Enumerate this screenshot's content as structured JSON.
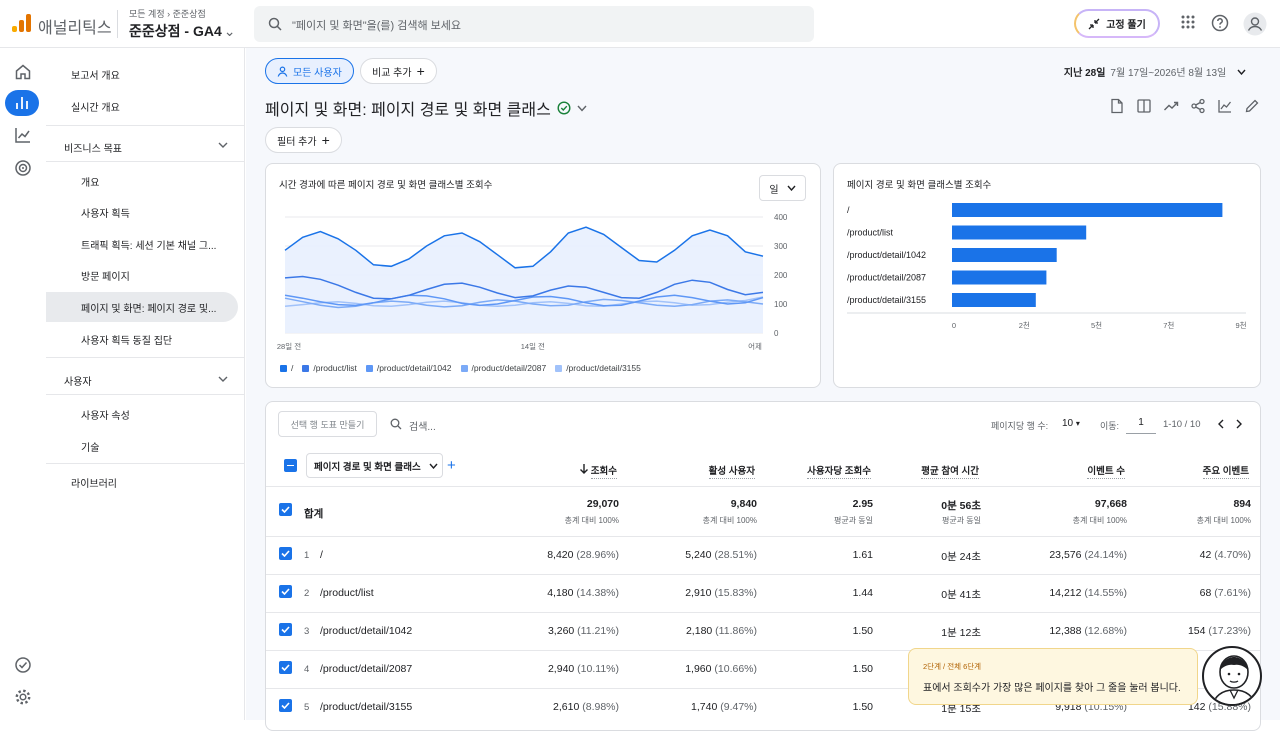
{
  "app": {
    "title": "애널리틱스",
    "breadcrumb": [
      "모든 계정",
      "준준상점"
    ],
    "property": "준준상점 - GA4",
    "search_placeholder": "\"페이지 및 화면\"을(를) 검색해 보세요",
    "pin_label": "고정 풀기",
    "logo_colors": [
      "#f9ab00",
      "#e37400",
      "#e37400"
    ]
  },
  "sidebar": {
    "items_top": [
      "보고서 개요",
      "실시간 개요"
    ],
    "section1": "비즈니스 목표",
    "section1_items": [
      "개요",
      "사용자 획득",
      "트래픽 획득: 세션 기본 채널 그...",
      "방문 페이지",
      "페이지 및 화면: 페이지 경로 및...",
      "사용자 획득 동질 집단"
    ],
    "section2": "사용자",
    "section2_items": [
      "사용자 속성",
      "기술"
    ],
    "library": "라이브러리"
  },
  "toolbar": {
    "segment": "모든 사용자",
    "compare": "비교 추가",
    "date_label": "지난 28일",
    "date_range": "7월 17일~2026년 8월 13일",
    "title": "페이지 및 화면: 페이지 경로 및 화면 클래스",
    "filter": "필터 추가"
  },
  "line_card": {
    "title": "시간 경과에 따른 페이지 경로 및 화면 클래스별 조회수",
    "granularity": "일",
    "yticks": [
      "400",
      "300",
      "200",
      "100",
      "0"
    ],
    "xticks": [
      "28일 전",
      "14일 전",
      "어제"
    ]
  },
  "bar_card": {
    "title": "페이지 경로 및 화면 클래스별 조회수",
    "xticks": [
      "0",
      "2천",
      "5천",
      "7천",
      "9천"
    ]
  },
  "chart_data": [
    {
      "type": "line",
      "title": "시간 경과에 따른 페이지 경로 및 화면 클래스별 조회수",
      "ylim": [
        0,
        400
      ],
      "x": [
        "28일 전",
        "",
        "",
        "",
        "",
        "",
        "",
        "",
        "",
        "",
        "",
        "",
        "",
        "",
        "14일 전",
        "",
        "",
        "",
        "",
        "",
        "",
        "",
        "",
        "",
        "",
        "",
        "",
        "어제"
      ],
      "series": [
        {
          "name": "/",
          "color": "#1a73e8",
          "values": [
            285,
            330,
            350,
            325,
            285,
            235,
            230,
            255,
            300,
            335,
            345,
            315,
            270,
            225,
            230,
            280,
            345,
            365,
            340,
            295,
            250,
            245,
            285,
            335,
            355,
            335,
            280,
            265
          ]
        },
        {
          "name": "/product/list",
          "color": "#3b78e7",
          "values": [
            190,
            195,
            185,
            165,
            140,
            120,
            118,
            130,
            150,
            168,
            172,
            158,
            138,
            122,
            128,
            148,
            162,
            158,
            140,
            122,
            120,
            140,
            168,
            182,
            175,
            150,
            132,
            140
          ]
        },
        {
          "name": "/product/detail/1042",
          "color": "#5e97f6",
          "values": [
            130,
            120,
            108,
            98,
            95,
            104,
            118,
            130,
            128,
            118,
            102,
            95,
            100,
            112,
            124,
            126,
            118,
            104,
            94,
            96,
            110,
            124,
            130,
            122,
            110,
            100,
            104,
            122
          ]
        },
        {
          "name": "/product/detail/2087",
          "color": "#7baaf7",
          "values": [
            120,
            108,
            96,
            88,
            92,
            104,
            110,
            106,
            96,
            90,
            94,
            106,
            114,
            110,
            100,
            94,
            96,
            108,
            116,
            112,
            104,
            96,
            92,
            98,
            110,
            114,
            108,
            100
          ]
        },
        {
          "name": "/product/detail/3155",
          "color": "#a1c2fa",
          "values": [
            92,
            98,
            104,
            108,
            102,
            94,
            92,
            98,
            106,
            110,
            104,
            96,
            92,
            96,
            104,
            108,
            102,
            94,
            92,
            100,
            108,
            110,
            104,
            96,
            98,
            106,
            112,
            124
          ]
        }
      ]
    },
    {
      "type": "bar",
      "title": "페이지 경로 및 화면 클래스별 조회수",
      "categories": [
        "/",
        "/product/list",
        "/product/detail/1042",
        "/product/detail/2087",
        "/product/detail/3155"
      ],
      "values": [
        8420,
        4180,
        3260,
        2940,
        2610
      ],
      "xlim": [
        0,
        9000
      ],
      "color": "#1a73e8"
    }
  ],
  "table": {
    "make_chart": "선택 행 도표 만들기",
    "search": "검색...",
    "rows_per_page_label": "페이지당 행 수:",
    "rows_per_page": "10",
    "goto_label": "이동:",
    "goto_value": "1",
    "range": "1-10 / 10",
    "dim_header": "페이지 경로 및 화면 클래스",
    "headers": [
      "조회수",
      "활성 사용자",
      "사용자당 조회수",
      "평균 참여 시간",
      "이벤트 수",
      "주요 이벤트"
    ],
    "total": {
      "label": "합계",
      "values": [
        "29,070",
        "9,840",
        "2.95",
        "0분 56초",
        "97,668",
        "894"
      ],
      "subs": [
        "총계 대비 100%",
        "총계 대비 100%",
        "평균과 동일",
        "평균과 동일",
        "총계 대비 100%",
        "총계 대비 100%"
      ]
    },
    "rows": [
      {
        "n": "1",
        "path": "/",
        "v": [
          [
            "8,420",
            "(28.96%)"
          ],
          [
            "5,240",
            "(28.51%)"
          ],
          [
            "1.61",
            ""
          ],
          [
            "0분 24초",
            ""
          ],
          [
            "23,576",
            "(24.14%)"
          ],
          [
            "42",
            "(4.70%)"
          ]
        ]
      },
      {
        "n": "2",
        "path": "/product/list",
        "v": [
          [
            "4,180",
            "(14.38%)"
          ],
          [
            "2,910",
            "(15.83%)"
          ],
          [
            "1.44",
            ""
          ],
          [
            "0분 41초",
            ""
          ],
          [
            "14,212",
            "(14.55%)"
          ],
          [
            "68",
            "(7.61%)"
          ]
        ]
      },
      {
        "n": "3",
        "path": "/product/detail/1042",
        "v": [
          [
            "3,260",
            "(11.21%)"
          ],
          [
            "2,180",
            "(11.86%)"
          ],
          [
            "1.50",
            ""
          ],
          [
            "1분 12초",
            ""
          ],
          [
            "12,388",
            "(12.68%)"
          ],
          [
            "154",
            "(17.23%)"
          ]
        ]
      },
      {
        "n": "4",
        "path": "/product/detail/2087",
        "v": [
          [
            "2,940",
            "(10.11%)"
          ],
          [
            "1,960",
            "(10.66%)"
          ],
          [
            "1.50",
            ""
          ],
          [
            "",
            ""
          ],
          [
            "",
            ""
          ],
          [
            "",
            ""
          ]
        ]
      },
      {
        "n": "5",
        "path": "/product/detail/3155",
        "v": [
          [
            "2,610",
            "(8.98%)"
          ],
          [
            "1,740",
            "(9.47%)"
          ],
          [
            "1.50",
            ""
          ],
          [
            "1분 15초",
            ""
          ],
          [
            "9,918",
            "(10.15%)"
          ],
          [
            "142",
            "(15.88%)"
          ]
        ]
      }
    ]
  },
  "tip": {
    "step": "2단계 / 전체 6단계",
    "message": "표에서 조회수가 가장 많은 페이지를 찾아 그 줄을 눌러 봅니다."
  }
}
